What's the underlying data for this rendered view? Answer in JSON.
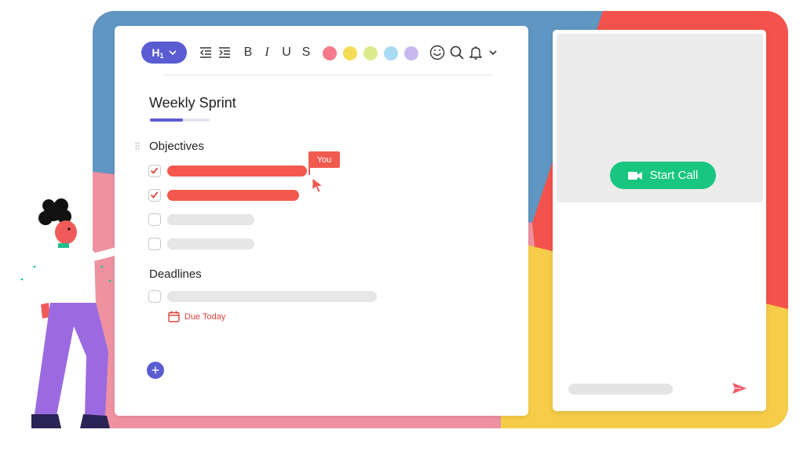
{
  "colors": {
    "brand_purple": "#5a5cd2",
    "done_red": "#f5584c",
    "call_green": "#18c67f",
    "backdrop_blue": "#6096c2",
    "backdrop_red": "#f4534d",
    "backdrop_yellow": "#f6cd48",
    "backdrop_pink": "#ee91a1"
  },
  "toolbar": {
    "heading_select": {
      "value": "H1",
      "icon": "chevron-down-icon"
    },
    "outdent_icon": "outdent-icon",
    "indent_icon": "indent-icon",
    "bold_label": "B",
    "italic_label": "I",
    "underline_label": "U",
    "strike_label": "S",
    "highlight_colors": [
      "#f57a8a",
      "#f5dc55",
      "#dbeb8c",
      "#a9dcf2",
      "#c8b8f0"
    ],
    "emoji_icon": "smiley-icon",
    "search_icon": "search-icon",
    "notification_icon": "bell-icon",
    "more_icon": "chevron-down-icon"
  },
  "document": {
    "title": "Weekly Sprint",
    "title_progress": 0.55,
    "sections": [
      {
        "heading": "Objectives",
        "items": [
          {
            "checked": true
          },
          {
            "checked": true
          },
          {
            "checked": false
          },
          {
            "checked": false
          }
        ]
      },
      {
        "heading": "Deadlines",
        "items": [
          {
            "checked": false
          }
        ]
      }
    ],
    "due_badge": {
      "label": "Due Today",
      "icon": "calendar-icon"
    },
    "collaborator_cursor": {
      "label": "You",
      "icon": "cursor-pointer-icon"
    },
    "add_button_label": "+"
  },
  "call_panel": {
    "start_call_label": "Start Call",
    "start_call_icon": "video-camera-icon",
    "send_icon": "send-icon"
  }
}
